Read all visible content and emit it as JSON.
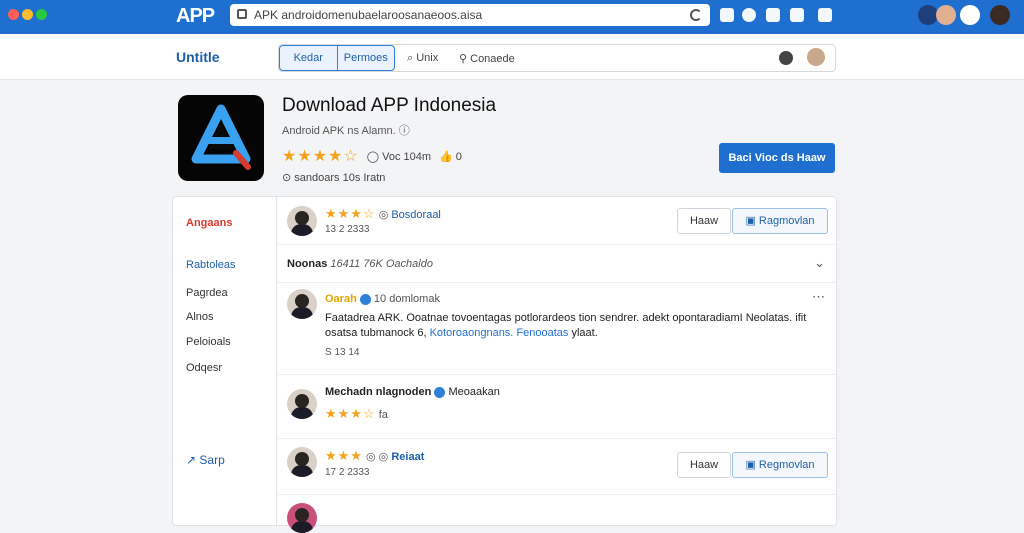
{
  "browser": {
    "brand": "APP",
    "url": "APK androidomenubaelaroosanaeoos.aisa"
  },
  "nav": {
    "title": "Untitle",
    "seg_left": "Kedar",
    "seg_right": "Permoes",
    "link1": "Unix",
    "link2": "Conaede"
  },
  "app": {
    "title": "Download APP Indonesia",
    "subtitle": "Android APK ns Alamn.",
    "stars": "★★★★☆",
    "comments": "Voc 104m",
    "likes": "0",
    "downloads": "sandoars 10s Iratn",
    "cta": "Baci Vioc ds Haaw"
  },
  "sidebar": {
    "items": [
      "Angaans",
      "Rabtoleas",
      "Pagrdea",
      "Alnos",
      "Peloioals",
      "Odqesr"
    ],
    "setup": "Sarp"
  },
  "reviews": {
    "r1_stars": "★★★☆",
    "r1_tag": "Bosdoraal",
    "r1_date": "13 2 2333",
    "r1_btn_left": "Haaw",
    "r1_btn_right": "Ragmovlan",
    "section_label": "Noonas",
    "section_meta": "16411 76K Oachaldo",
    "comment_author": "Oarah",
    "comment_meta": "10 domlomak",
    "comment_text_1": "Faatadrea ARK. Ooatnae tovoentagas potlorardeos tion sendrer. adekt opontaradiamI Neolatas.",
    "comment_text_2": "ifit osatsa tubmanock 6,",
    "comment_link_1": "Kotoroaongnans.",
    "comment_link_2": "Fenooatas",
    "comment_text_3": "ylaat.",
    "comment_small": "S 13 14",
    "r2_author": "Mechadn nlagnoden",
    "r2_badge": "Meoaakan",
    "r2_stars": "★★★☆",
    "r2_count": "fa",
    "r3_stars": "★★★",
    "r3_tag": "Reiaat",
    "r3_date": "17 2 2333",
    "r3_btn_left": "Haaw",
    "r3_btn_right": "Regmovlan"
  },
  "colors": {
    "accent": "#1f6fd1",
    "star": "#f2a21b",
    "sidebar_red": "#d83b2e"
  }
}
